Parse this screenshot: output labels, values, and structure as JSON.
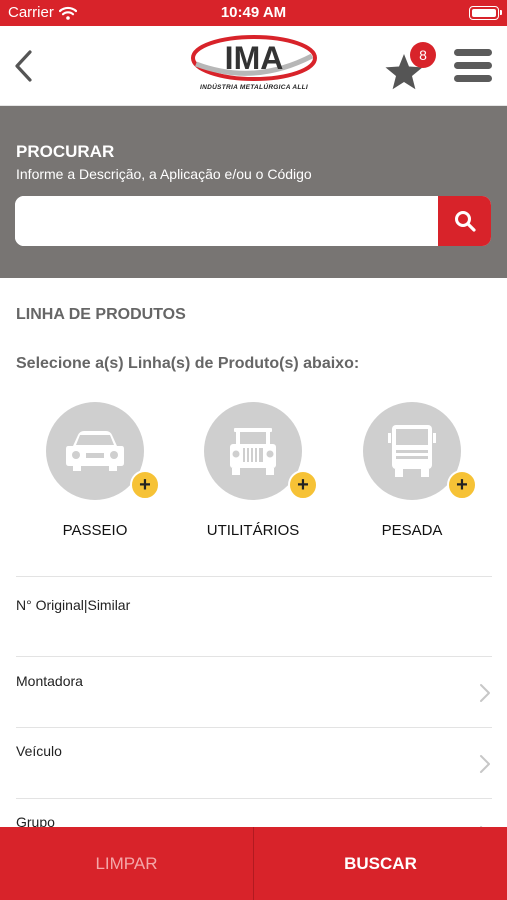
{
  "status_bar": {
    "carrier": "Carrier",
    "time": "10:49 AM"
  },
  "header": {
    "logo_text": "IMA",
    "logo_tagline": "INDÚSTRIA METALÚRGICA ALLI",
    "favorites_count": "8",
    "icons": [
      "back-chevron-icon",
      "star-icon",
      "hamburger-menu-icon"
    ]
  },
  "search": {
    "title": "PROCURAR",
    "subtitle": "Informe a Descrição, a Aplicação e/ou o Código",
    "value": "",
    "placeholder": "",
    "button_icon": "search-icon"
  },
  "product_lines": {
    "title": "LINHA DE PRODUTOS",
    "instruction": "Selecione a(s) Linha(s) de Produto(s) abaixo:",
    "items": [
      {
        "label": "PASSEIO",
        "icon": "car-icon"
      },
      {
        "label": "UTILITÁRIOS",
        "icon": "jeep-icon"
      },
      {
        "label": "PESADA",
        "icon": "truck-icon"
      }
    ],
    "add_symbol": "+"
  },
  "filters": [
    {
      "label": "N° Original|Similar",
      "has_chevron": false
    },
    {
      "label": "Montadora",
      "has_chevron": true
    },
    {
      "label": "Veículo",
      "has_chevron": true
    },
    {
      "label": "Grupo",
      "has_chevron": true
    }
  ],
  "actions": {
    "clear_label": "LIMPAR",
    "search_label": "BUSCAR"
  },
  "colors": {
    "brand_red": "#d8232a",
    "search_band_gray": "#787573",
    "badge_yellow": "#f6c236",
    "circle_gray": "#cfcfcf"
  }
}
